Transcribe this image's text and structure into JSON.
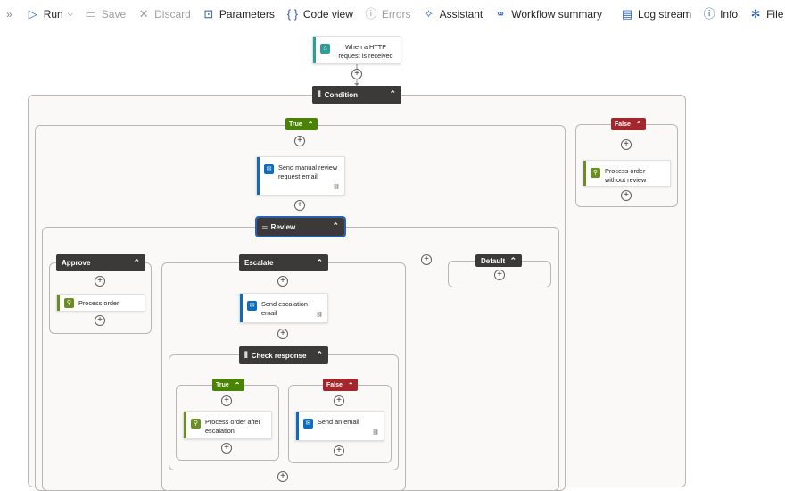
{
  "toolbar": {
    "run": "Run",
    "save": "Save",
    "discard": "Discard",
    "parameters": "Parameters",
    "code_view": "Code view",
    "errors": "Errors",
    "assistant": "Assistant",
    "workflow_summary": "Workflow summary",
    "log_stream": "Log stream",
    "info": "Info",
    "file_a_bug": "File a bug"
  },
  "trigger": {
    "title": "When a HTTP request is received",
    "color": "#2e9f97"
  },
  "condition": {
    "title": "Condition",
    "true_label": "True",
    "false_label": "False",
    "true_branch": {
      "email_action": "Send manual review request email",
      "switch": {
        "title": "Review",
        "cases": {
          "approve": {
            "title": "Approve",
            "action": "Process order"
          },
          "escalate": {
            "title": "Escalate",
            "action": "Send escalation email",
            "inner_condition": {
              "title": "Check response",
              "true_label": "True",
              "false_label": "False",
              "true_action": "Process order after escalation",
              "false_action": "Send an email"
            }
          },
          "default": {
            "title": "Default"
          }
        }
      }
    },
    "false_branch": {
      "action": "Process order without review"
    }
  },
  "colors": {
    "accent": "#2b5fb4",
    "true_green": "#498205",
    "false_red": "#a4262c",
    "header_dark": "#3b3a39",
    "outlook_blue": "#0f6cbd",
    "function_green": "#6b8e23"
  }
}
